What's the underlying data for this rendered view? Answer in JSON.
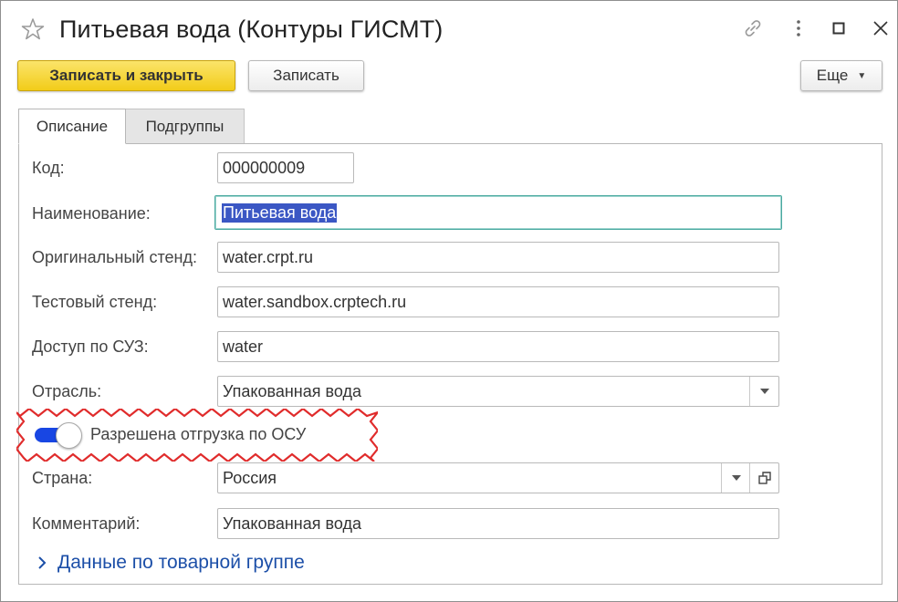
{
  "window": {
    "title": "Питьевая вода (Контуры ГИСМТ)",
    "icons": [
      "star-icon",
      "link-icon",
      "more-vertical-icon",
      "maximize-icon",
      "close-icon"
    ]
  },
  "toolbar": {
    "save_close_label": "Записать и закрыть",
    "save_label": "Записать",
    "more_label": "Еще"
  },
  "tabs": [
    {
      "label": "Описание",
      "active": true
    },
    {
      "label": "Подгруппы",
      "active": false
    }
  ],
  "form": {
    "code": {
      "label": "Код:",
      "value": "000000009"
    },
    "name": {
      "label": "Наименование:",
      "value": "Питьевая вода"
    },
    "original_stand": {
      "label": "Оригинальный стенд:",
      "value": "water.crpt.ru"
    },
    "test_stand": {
      "label": "Тестовый стенд:",
      "value": "water.sandbox.crptech.ru"
    },
    "suz_access": {
      "label": "Доступ по СУЗ:",
      "value": "water"
    },
    "industry": {
      "label": "Отрасль:",
      "value": "Упакованная вода"
    },
    "osu_toggle": {
      "label": "Разрешена отгрузка по ОСУ",
      "checked": true
    },
    "country": {
      "label": "Страна:",
      "value": "Россия"
    },
    "comment": {
      "label": "Комментарий:",
      "value": "Упакованная вода"
    }
  },
  "group_link": {
    "label": "Данные по товарной группе"
  },
  "colors": {
    "primary_button": "#f2cc19",
    "toggle_on": "#1846e3",
    "highlight": "#e02b2b",
    "link": "#1c4fa8",
    "selection": "#3b57c4"
  }
}
